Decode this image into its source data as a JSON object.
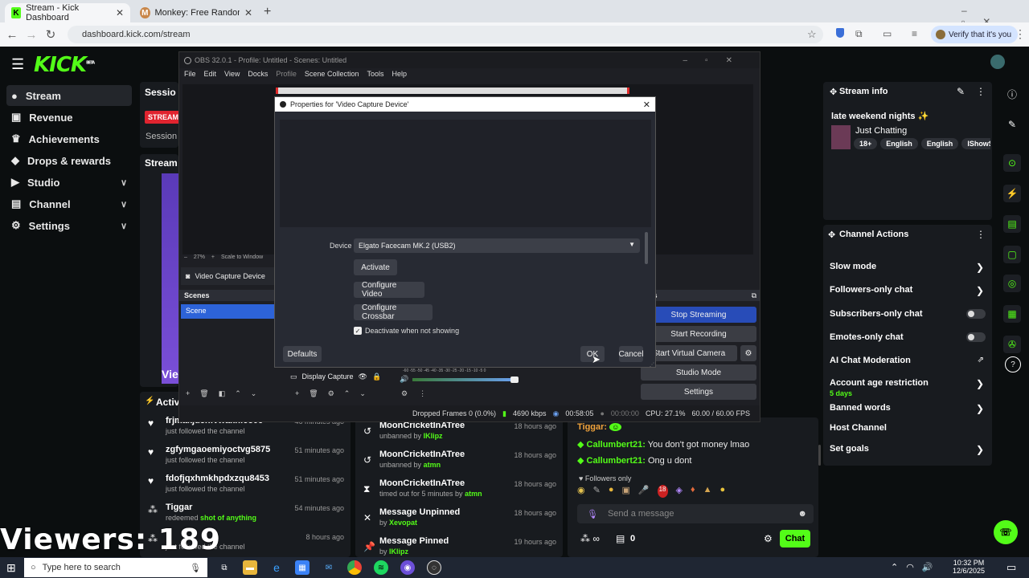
{
  "browser": {
    "tabs": [
      {
        "title": "Stream - Kick Dashboard",
        "icon": "K"
      },
      {
        "title": "Monkey: Free Random Video C",
        "icon": "M"
      }
    ],
    "url": "dashboard.kick.com/stream",
    "verify": "Verify that it's you"
  },
  "kick": {
    "logo": "KICK",
    "logo_badge": "BETA",
    "sidebar": [
      {
        "label": "Stream",
        "icon": "stream-icon",
        "active": true
      },
      {
        "label": "Revenue",
        "icon": "revenue-icon"
      },
      {
        "label": "Achievements",
        "icon": "trophy-icon"
      },
      {
        "label": "Drops & rewards",
        "icon": "gift-icon"
      },
      {
        "label": "Studio",
        "icon": "video-icon",
        "chevron": "∨"
      },
      {
        "label": "Channel",
        "icon": "channel-icon",
        "chevron": "∨"
      },
      {
        "label": "Settings",
        "icon": "gear-icon",
        "chevron": "∨"
      }
    ],
    "session": {
      "title": "Sessio",
      "badge": "STREAMI",
      "label": "Session",
      "stream": "Stream",
      "activity": "Activit",
      "preview_text": "Vie"
    }
  },
  "stream_info": {
    "title": "Stream info",
    "stream_title": "late weekend nights",
    "category": "Just Chatting",
    "tags": [
      "18+",
      "English",
      "English",
      "IShowSpe"
    ]
  },
  "channel_actions": {
    "title": "Channel Actions",
    "items": [
      {
        "label": "Slow mode",
        "type": "arrow"
      },
      {
        "label": "Followers-only chat",
        "type": "arrow"
      },
      {
        "label": "Subscribers-only chat",
        "type": "toggle"
      },
      {
        "label": "Emotes-only chat",
        "type": "toggle"
      },
      {
        "label": "AI Chat Moderation",
        "type": "external"
      },
      {
        "label": "Account age restriction",
        "type": "arrow",
        "sub": "5 days"
      },
      {
        "label": "Banned words",
        "type": "arrow"
      },
      {
        "label": "Host Channel",
        "type": "none"
      },
      {
        "label": "Set goals",
        "type": "arrow"
      }
    ]
  },
  "activity": [
    {
      "user": "frjmakjdcnfvwakhf9506",
      "sub": "just followed the channel",
      "time": "46 minutes ago"
    },
    {
      "user": "zgfymgaoemiyoctvg5875",
      "sub": "just followed the channel",
      "time": "51 minutes ago"
    },
    {
      "user": "fdofjqxhmkhpdxzqu8453",
      "sub": "just followed the channel",
      "time": "51 minutes ago"
    },
    {
      "user": "Tiggar",
      "sub": "redeemed ",
      "sub_green": "shot of anything",
      "time": "54 minutes ago"
    },
    {
      "user": "",
      "sub": "just followed the channel",
      "time": "8 hours ago"
    }
  ],
  "modlog": [
    {
      "user": "MoonCricketInATree",
      "sub": "unbanned by ",
      "by": "IKlipz",
      "time": "18 hours ago"
    },
    {
      "user": "MoonCricketInATree",
      "sub": "unbanned by ",
      "by": "atmn",
      "time": "18 hours ago"
    },
    {
      "user": "MoonCricketInATree",
      "sub": "timed out for 5 minutes by ",
      "by": "atmn",
      "time": "18 hours ago"
    },
    {
      "user": "Message Unpinned",
      "sub": "by ",
      "by": "Xevopat",
      "time": "18 hours ago"
    },
    {
      "user": "Message Pinned",
      "sub": "by ",
      "by": "IKlipz",
      "time": "19 hours ago"
    }
  ],
  "chat": {
    "messages": [
      {
        "user": "Tiggar:",
        "text": ""
      },
      {
        "user": "Callumbert21:",
        "text": "You don't got money lmao"
      },
      {
        "user": "Callumbert21:",
        "text": "Ong u dont"
      }
    ],
    "followers_only": "Followers only",
    "placeholder": "Send a message",
    "count": "0",
    "send": "Chat"
  },
  "viewers": "Viewers: 189",
  "obs": {
    "title": "OBS 32.0.1 - Profile: Untitled - Scenes: Untitled",
    "menu": [
      "File",
      "Edit",
      "View",
      "Docks",
      "Profile",
      "Scene Collection",
      "Tools",
      "Help"
    ],
    "zoom": "27%",
    "scale": "Scale to Window",
    "source_selected": "Video Capture Device",
    "scenes_title": "Scenes",
    "scene": "Scene",
    "source_display": "Display Capture",
    "controls_title": "rols",
    "controls": [
      "Stop Streaming",
      "Start Recording",
      "Start Virtual Camera",
      "Studio Mode",
      "Settings"
    ],
    "meter_ticks": "-60 -55 -50 -45 -40 -35 -30 -25 -20 -15 -10 -5 0",
    "status": {
      "dropped": "Dropped Frames 0 (0.0%)",
      "kbps": "4690 kbps",
      "stream_time": "00:58:05",
      "rec_time": "00:00:00",
      "cpu": "CPU: 27.1%",
      "fps": "60.00 / 60.00 FPS"
    }
  },
  "dialog": {
    "title": "Properties for 'Video Capture Device'",
    "device_label": "Device",
    "device_value": "Elgato Facecam MK.2 (USB2)",
    "buttons": [
      "Activate",
      "Configure Video",
      "Configure Crossbar"
    ],
    "checkbox": "Deactivate when not showing",
    "defaults": "Defaults",
    "ok": "OK",
    "cancel": "Cancel"
  },
  "taskbar": {
    "search": "Type here to search",
    "time": "10:32 PM",
    "date": "12/6/2025"
  }
}
